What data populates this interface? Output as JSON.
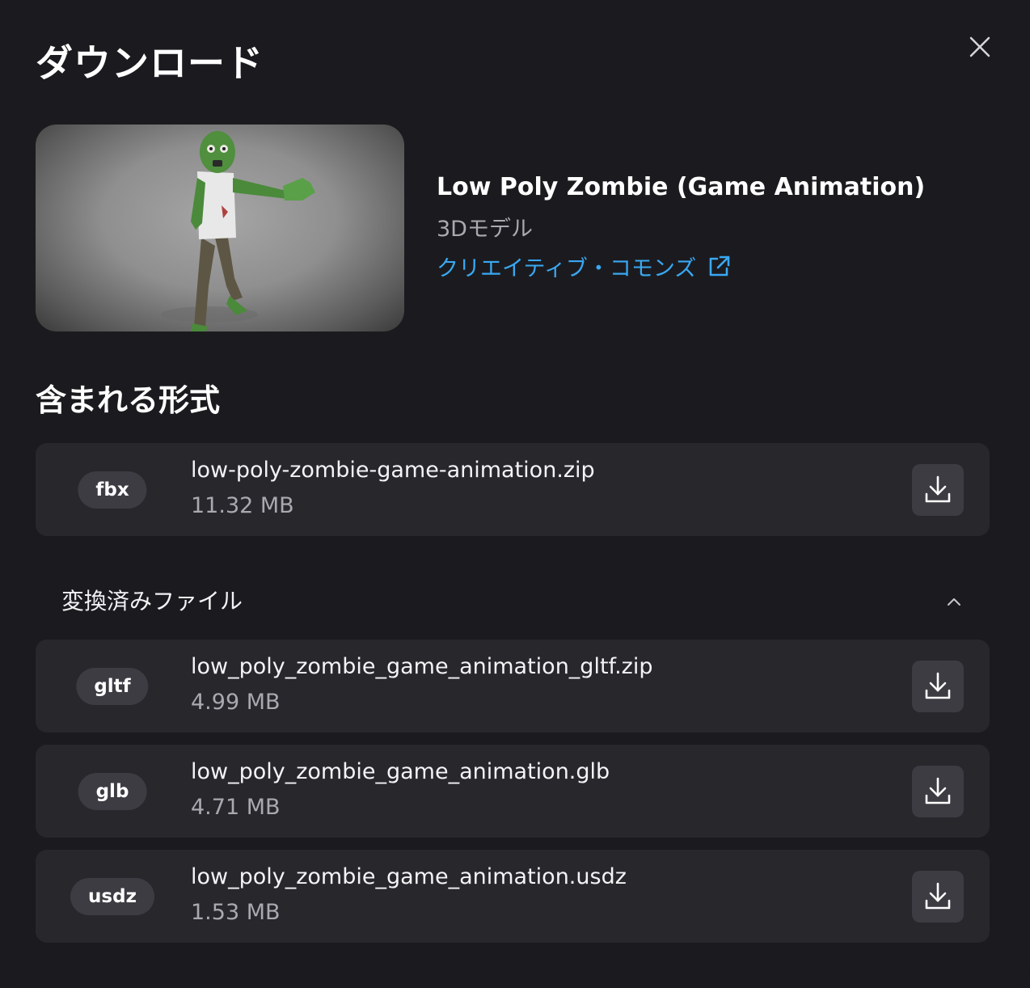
{
  "dialog": {
    "title": "ダウンロード",
    "close_icon": "close-icon"
  },
  "model": {
    "name": "Low Poly Zombie (Game Animation)",
    "type": "3Dモデル",
    "license": "クリエイティブ・コモンズ",
    "license_icon": "external-link-icon"
  },
  "included": {
    "title": "含まれる形式",
    "files": [
      {
        "format": "fbx",
        "filename": "low-poly-zombie-game-animation.zip",
        "size": "11.32 MB"
      }
    ]
  },
  "converted": {
    "title": "変換済みファイル",
    "expanded_icon": "chevron-up-icon",
    "files": [
      {
        "format": "gltf",
        "filename": "low_poly_zombie_game_animation_gltf.zip",
        "size": "4.99 MB"
      },
      {
        "format": "glb",
        "filename": "low_poly_zombie_game_animation.glb",
        "size": "4.71 MB"
      },
      {
        "format": "usdz",
        "filename": "low_poly_zombie_game_animation.usdz",
        "size": "1.53 MB"
      }
    ]
  },
  "colors": {
    "background": "#1b1b1f",
    "row": "#27272c",
    "button": "#3c3c42",
    "link": "#39a8f2",
    "secondary_text": "#a9a9b0"
  }
}
